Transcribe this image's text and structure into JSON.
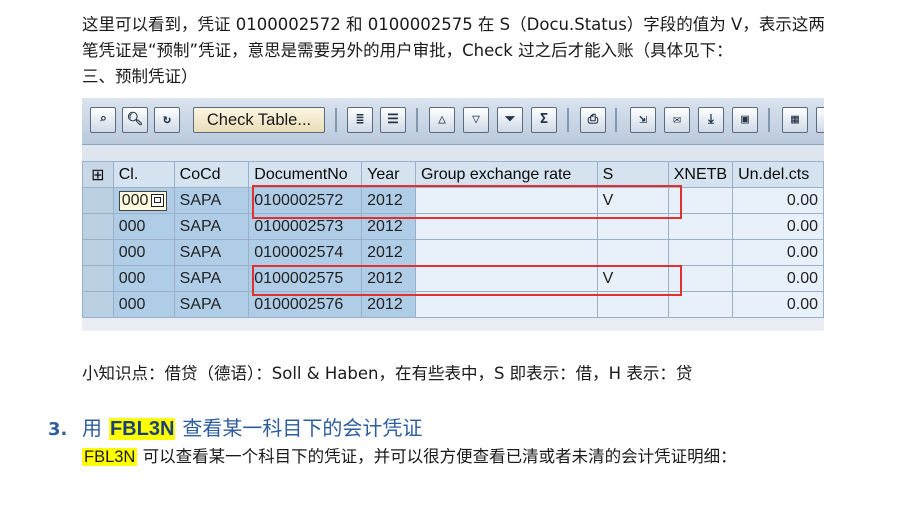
{
  "intro": {
    "line1": "这里可以看到，凭证 0100002572 和 0100002575 在 S（Docu.Status）字段的值为 V，表示这两",
    "line2": "笔凭证是“预制”凭证，意思是需要另外的用户审批，Check 过之后才能入账（具体见下：",
    "line3": "三、预制凭证）"
  },
  "toolbar": {
    "check_table_label": "Check Table...",
    "icons": [
      "details-icon",
      "find-icon",
      "refresh-icon",
      "check-table-button",
      "select-all-icon",
      "deselect-all-icon",
      "sort-ascending-icon",
      "sort-descending-icon",
      "filter-icon",
      "total-icon",
      "print-icon",
      "export-icon",
      "mail-icon",
      "save-icon",
      "delete-icon",
      "layout-icon",
      "grid-icon"
    ]
  },
  "table": {
    "columns": [
      "Cl.",
      "CoCd",
      "DocumentNo",
      "Year",
      "Group exchange rate",
      "S",
      "XNETB",
      "Un.del.cts"
    ],
    "rows": [
      {
        "cl": "000",
        "cocd": "SAPA",
        "docno": "0100002572",
        "year": "2012",
        "rate": "",
        "s": "V",
        "xnetb": "",
        "undel": "0.00"
      },
      {
        "cl": "000",
        "cocd": "SAPA",
        "docno": "0100002573",
        "year": "2012",
        "rate": "",
        "s": "",
        "xnetb": "",
        "undel": "0.00"
      },
      {
        "cl": "000",
        "cocd": "SAPA",
        "docno": "0100002574",
        "year": "2012",
        "rate": "",
        "s": "",
        "xnetb": "",
        "undel": "0.00"
      },
      {
        "cl": "000",
        "cocd": "SAPA",
        "docno": "0100002575",
        "year": "2012",
        "rate": "",
        "s": "V",
        "xnetb": "",
        "undel": "0.00"
      },
      {
        "cl": "000",
        "cocd": "SAPA",
        "docno": "0100002576",
        "year": "2012",
        "rate": "",
        "s": "",
        "xnetb": "",
        "undel": "0.00"
      }
    ]
  },
  "tip": "小知识点：借贷（德语）：Soll & Haben，在有些表中，S 即表示：借，H 表示：贷",
  "section": {
    "number": "3.",
    "prefix": "用",
    "keyword": "FBL3N",
    "title_rest": "查看某一科目下的会计凭证",
    "body_keyword": "FBL3N",
    "body_rest": "可以查看某一个科目下的凭证，并可以很方便查看已清或者未清的会计凭证明细："
  },
  "colors": {
    "highlight": "#ffff00",
    "heading": "#2e5d9e",
    "annotation_box": "#e03030"
  }
}
